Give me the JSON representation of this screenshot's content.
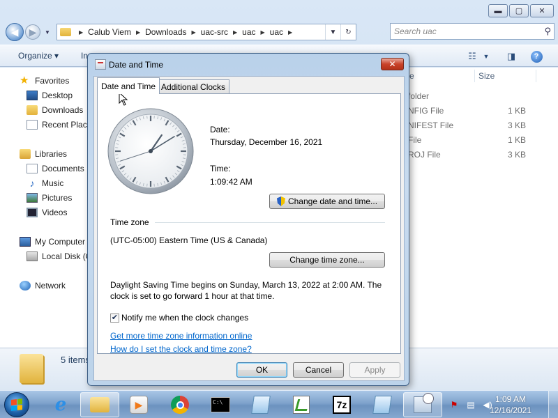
{
  "explorer": {
    "window_buttons": {
      "minimize": "▬",
      "maximize": "▢",
      "close": "✕"
    },
    "address": {
      "crumbs": [
        "Calub Viem",
        "Downloads",
        "uac-src",
        "uac",
        "uac"
      ],
      "dropdown_icon": "▼",
      "refresh_icon": "↻"
    },
    "search": {
      "placeholder": "Search uac"
    },
    "toolbar": {
      "organize": "Organize ▾",
      "include": "In"
    },
    "nav": {
      "favorites": "Favorites",
      "desktop": "Desktop",
      "downloads": "Downloads",
      "recent_places": "Recent Place",
      "libraries": "Libraries",
      "documents": "Documents",
      "music": "Music",
      "pictures": "Pictures",
      "videos": "Videos",
      "my_computer": "My Computer",
      "local_disk": "Local Disk (C",
      "network": "Network"
    },
    "files": {
      "col_type_fragment": "e",
      "col_size": "Size",
      "rows": [
        {
          "type": "folder",
          "size": ""
        },
        {
          "type": "NFIG File",
          "size": "1 KB"
        },
        {
          "type": "NIFEST File",
          "size": "3 KB"
        },
        {
          "type": "File",
          "size": "1 KB"
        },
        {
          "type": "ROJ File",
          "size": "3 KB"
        }
      ]
    },
    "details": {
      "items_count": "5 items"
    }
  },
  "dialog": {
    "title": "Date and Time",
    "close": "✕",
    "tabs": [
      "Date and Time",
      "Additional Clocks"
    ],
    "date_label": "Date:",
    "date_value": "Thursday, December 16, 2021",
    "time_label": "Time:",
    "time_value": "1:09:42 AM",
    "clock": {
      "hour": 1,
      "minute": 9,
      "second": 42
    },
    "change_datetime_button": "Change date and time...",
    "timezone_heading": "Time zone",
    "timezone_value": "(UTC-05:00) Eastern Time (US & Canada)",
    "change_timezone_button": "Change time zone...",
    "dst_line1": "Daylight Saving Time begins on Sunday, March 13, 2022 at 2:00 AM. The",
    "dst_line2": "clock is set to go forward 1 hour at that time.",
    "notify_checkbox": {
      "label": "Notify me when the clock changes",
      "checked": true
    },
    "link_more_info": "Get more time zone information online",
    "link_how_to": "How do I set the clock and time zone?",
    "ok": "OK",
    "cancel": "Cancel",
    "apply": "Apply"
  },
  "taskbar": {
    "apps": [
      "internet-explorer",
      "windows-explorer",
      "windows-media-player",
      "chrome",
      "command-prompt",
      "notepad",
      "notepad-plus-plus",
      "7-zip",
      "date-and-time"
    ],
    "clock_time": "1:09 AM",
    "clock_date": "12/16/2021"
  },
  "colors": {
    "accent": "#3c7fb1",
    "link": "#0066cc",
    "close_red": "#c9432a"
  }
}
